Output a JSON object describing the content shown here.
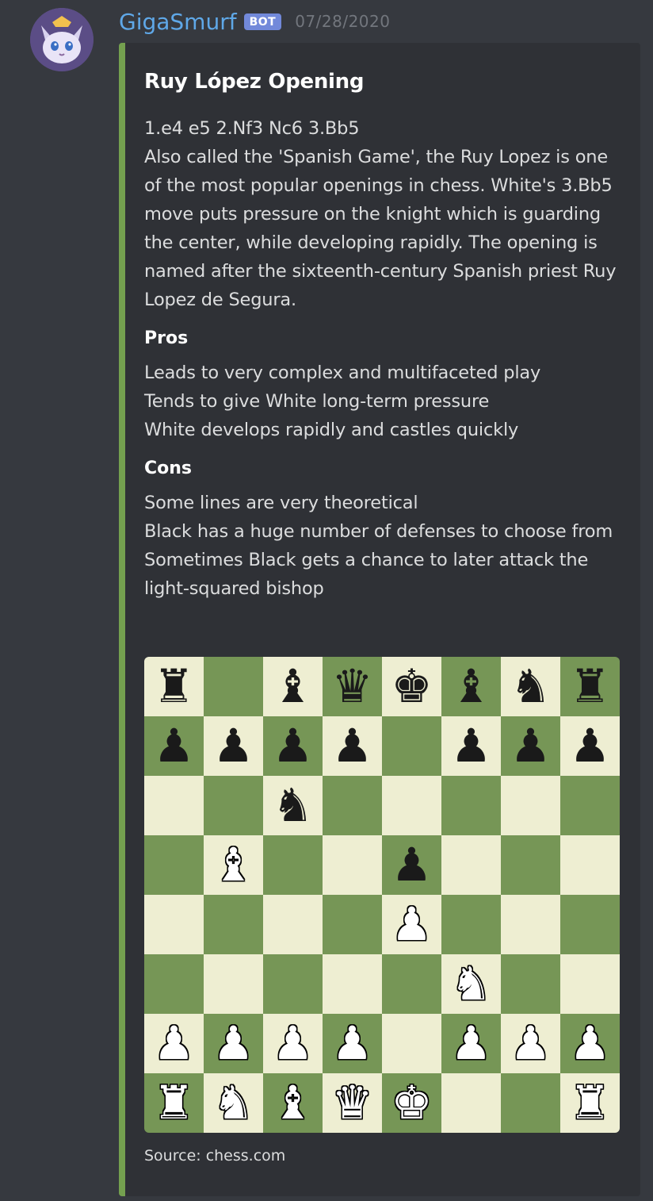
{
  "message": {
    "username": "GigaSmurf",
    "bot_tag": "BOT",
    "timestamp": "07/28/2020",
    "avatar_icon": "cat-avatar-icon",
    "colors": {
      "username": "#5fa8e8",
      "bot_tag": "#7289da",
      "embed_border": "#74a04f",
      "board_light": "#eeeed2",
      "board_dark": "#769656"
    }
  },
  "embed": {
    "title": "Ruy López Opening",
    "description_lines": [
      "1.e4 e5 2.Nf3 Nc6 3.Bb5",
      "Also called the 'Spanish Game', the Ruy Lopez is one of the most popular openings in chess. White's 3.Bb5 move puts pressure on the knight which is guarding the center, while developing rapidly. The opening is named after the sixteenth-century Spanish priest Ruy Lopez de Segura."
    ],
    "pros": {
      "name": "Pros",
      "items": [
        "Leads to very complex and multifaceted play",
        "Tends to give White long-term pressure",
        "White develops rapidly and castles quickly"
      ]
    },
    "cons": {
      "name": "Cons",
      "items": [
        "Some lines are very theoretical",
        "Black has a huge number of defenses to choose from",
        "Sometimes Black gets a chance to later attack the light-squared bishop"
      ]
    },
    "board": [
      [
        "br",
        "",
        "bb",
        "bq",
        "bk",
        "bb",
        "bn",
        "br"
      ],
      [
        "bp",
        "bp",
        "bp",
        "bp",
        "",
        "bp",
        "bp",
        "bp"
      ],
      [
        "",
        "",
        "bn",
        "",
        "",
        "",
        "",
        ""
      ],
      [
        "",
        "wb",
        "",
        "",
        "bp",
        "",
        "",
        ""
      ],
      [
        "",
        "",
        "",
        "",
        "wp",
        "",
        "",
        ""
      ],
      [
        "",
        "",
        "",
        "",
        "",
        "wn",
        "",
        ""
      ],
      [
        "wp",
        "wp",
        "wp",
        "wp",
        "",
        "wp",
        "wp",
        "wp"
      ],
      [
        "wr",
        "wn",
        "wb",
        "wq",
        "wk",
        "",
        "",
        "wr"
      ]
    ],
    "footer": "Source: chess.com"
  }
}
